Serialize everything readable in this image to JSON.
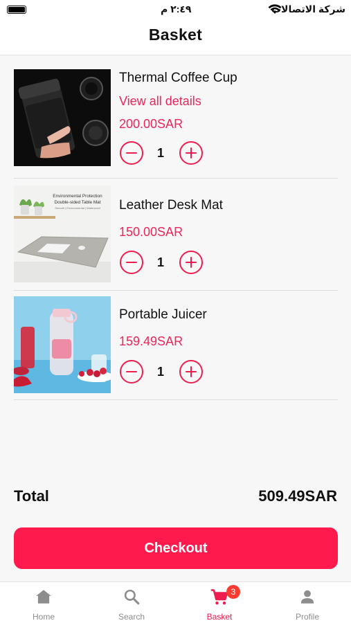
{
  "status_bar": {
    "time": "٢:٤٩ م",
    "carrier": "شركة الاتصالات"
  },
  "header": {
    "title": "Basket"
  },
  "items": [
    {
      "name": "Thermal Coffee Cup",
      "details_link": "View all details",
      "price": "200.00SAR",
      "quantity": "1",
      "image": "black-thermal-cup"
    },
    {
      "name": "Leather Desk Mat",
      "price": "150.00SAR",
      "quantity": "1",
      "image": "grey-desk-mat",
      "image_text": [
        "Environmental Protection",
        "Double-sided Table Mat",
        "Smooth | Environmental | Waterproof"
      ]
    },
    {
      "name": "Portable Juicer",
      "price": "159.49SAR",
      "quantity": "1",
      "image": "pink-juicer"
    }
  ],
  "total": {
    "label": "Total",
    "value": "509.49SAR"
  },
  "checkout": {
    "label": "Checkout"
  },
  "tabs": [
    {
      "label": "Home",
      "icon": "home-icon"
    },
    {
      "label": "Search",
      "icon": "search-icon"
    },
    {
      "label": "Basket",
      "icon": "cart-icon",
      "badge": "3",
      "active": true
    },
    {
      "label": "Profile",
      "icon": "person-icon"
    }
  ],
  "colors": {
    "accent": "#ee1d4f",
    "checkout_bg": "#ff1a4e",
    "badge": "#ff3b30",
    "inactive_tab": "#8d8d8d"
  }
}
